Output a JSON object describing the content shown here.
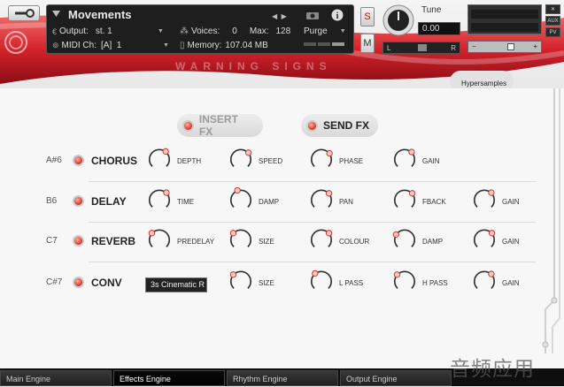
{
  "header": {
    "instrument_name": "Movements",
    "output_label": "Output:",
    "output_value": "st. 1",
    "voices_label": "Voices:",
    "voices_value": "0",
    "max_label": "Max:",
    "max_value": "128",
    "purge_label": "Purge",
    "midi_label": "MIDI Ch:",
    "midi_value": "[A]  1",
    "memory_label": "Memory:",
    "memory_value": "107.04 MB",
    "solo_label": "S",
    "mute_label": "M",
    "tune_label": "Tune",
    "tune_value": "0.00",
    "pan_left": "L",
    "pan_right": "R",
    "aux_label": "AUX",
    "pv_label": "PV",
    "banner_text": "WARNING SIGNS",
    "brand": "Hypersamples"
  },
  "fx_toggles": {
    "insert": "INSERT FX",
    "send": "SEND FX"
  },
  "fx_rows": [
    {
      "note": "A#6",
      "name": "CHORUS",
      "params": [
        "DEPTH",
        "SPEED",
        "PHASE",
        "GAIN"
      ]
    },
    {
      "note": "B6",
      "name": "DELAY",
      "params": [
        "TIME",
        "DAMP",
        "PAN",
        "FBACK",
        "GAIN"
      ]
    },
    {
      "note": "C7",
      "name": "REVERB",
      "params": [
        "PREDELAY",
        "SIZE",
        "COLOUR",
        "DAMP",
        "GAIN"
      ]
    },
    {
      "note": "C#7",
      "name": "CONV",
      "ir_select": "3s Cinematic R",
      "params": [
        "SIZE",
        "L PASS",
        "H PASS",
        "GAIN"
      ]
    }
  ],
  "tabs": [
    "Main Engine",
    "Effects Engine",
    "Rhythm Engine",
    "Output Engine"
  ],
  "active_tab": "Effects Engine",
  "watermark": "音频应用",
  "colors": {
    "accent_red": "#c8202a",
    "led_red": "#e04a3b"
  },
  "icons": [
    "wrench-icon",
    "camera-icon",
    "info-icon",
    "tune-knob-icon"
  ]
}
